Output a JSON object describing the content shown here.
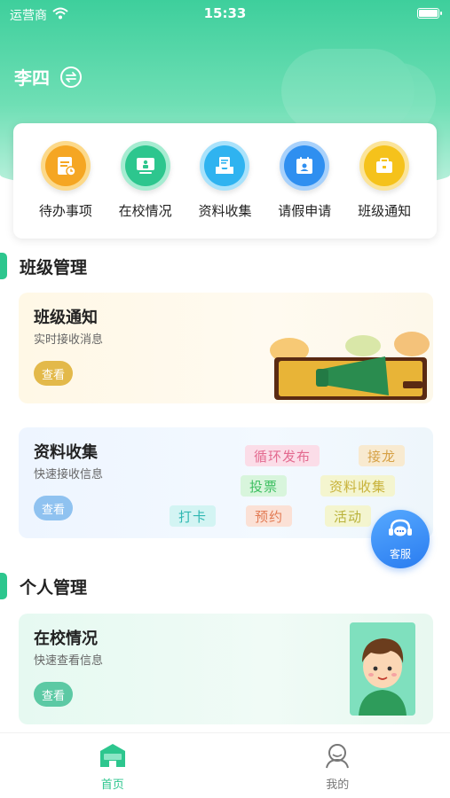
{
  "status_bar": {
    "carrier": "运营商",
    "time": "15:33",
    "battery_level": 1.0
  },
  "user": {
    "name": "李四"
  },
  "quick_actions": [
    {
      "label": "待办事项",
      "icon": "todo-list-icon",
      "color": "#f5a623"
    },
    {
      "label": "在校情况",
      "icon": "school-status-icon",
      "color": "#2dc68e"
    },
    {
      "label": "资料收集",
      "icon": "document-tray-icon",
      "color": "#2fb3f0"
    },
    {
      "label": "请假申请",
      "icon": "leave-calendar-icon",
      "color": "#2f8ff0"
    },
    {
      "label": "班级通知",
      "icon": "briefcase-notice-icon",
      "color": "#f5c21b"
    }
  ],
  "sections": {
    "class_management": "班级管理",
    "personal_management": "个人管理"
  },
  "cards": {
    "class_notice": {
      "title": "班级通知",
      "subtitle": "实时接收消息",
      "button": "查看"
    },
    "data_collection": {
      "title": "资料收集",
      "subtitle": "快速接收信息",
      "button": "查看",
      "tags": [
        "循环发布",
        "接龙",
        "投票",
        "资料收集",
        "打卡",
        "预约",
        "活动"
      ]
    },
    "school_status": {
      "title": "在校情况",
      "subtitle": "快速查看信息",
      "button": "查看"
    }
  },
  "customer_service": {
    "label": "客服"
  },
  "tabbar": {
    "home": "首页",
    "mine": "我的",
    "active": "home"
  },
  "colors": {
    "accent": "#2dc68e",
    "header_top": "#3ecf9c",
    "notice_button": "#e3b94a",
    "collect_button": "#8fc2f0",
    "status_button": "#5cc9a4"
  }
}
